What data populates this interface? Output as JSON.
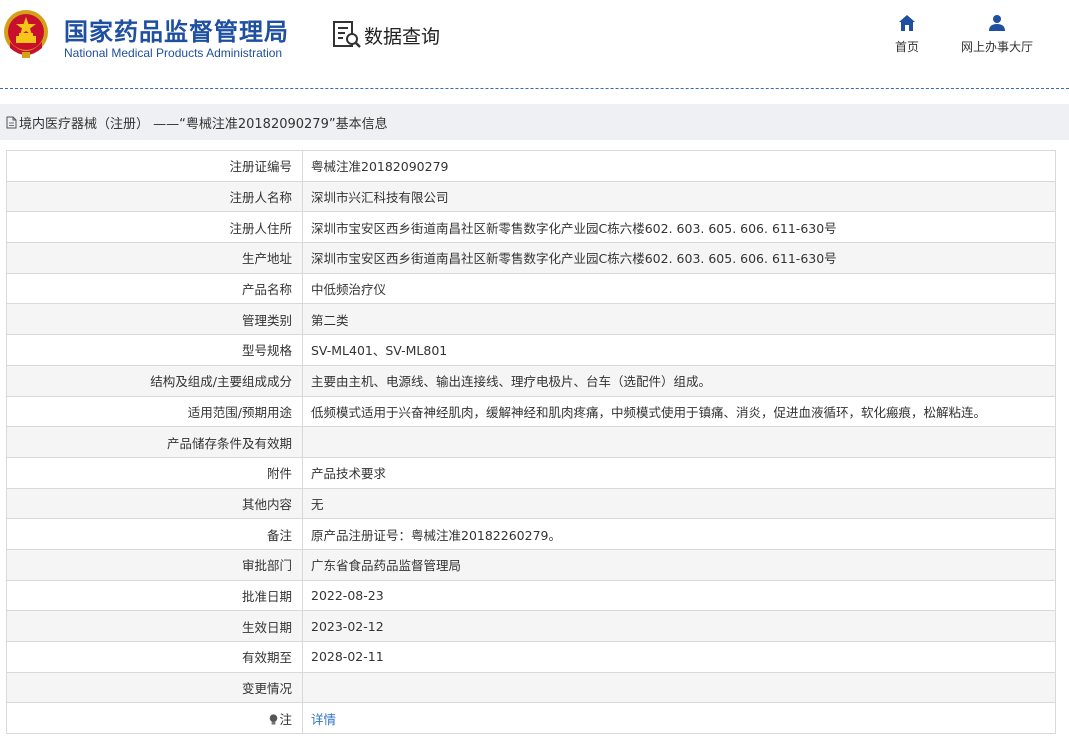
{
  "header": {
    "agency_cn": "国家药品监督管理局",
    "agency_en": "National Medical Products Administration",
    "query_label": "数据查询",
    "nav": [
      {
        "label": "首页",
        "icon": "home-icon"
      },
      {
        "label": "网上办事大厅",
        "icon": "user-icon"
      }
    ]
  },
  "breadcrumb": "境内医疗器械（注册） ——“粤械注准20182090279”基本信息",
  "rows": [
    {
      "label": "注册证编号",
      "value": "粤械注准20182090279"
    },
    {
      "label": "注册人名称",
      "value": "深圳市兴汇科技有限公司"
    },
    {
      "label": "注册人住所",
      "value": "深圳市宝安区西乡街道南昌社区新零售数字化产业园C栋六楼602. 603. 605. 606. 611-630号"
    },
    {
      "label": "生产地址",
      "value": "深圳市宝安区西乡街道南昌社区新零售数字化产业园C栋六楼602. 603. 605. 606. 611-630号"
    },
    {
      "label": "产品名称",
      "value": "中低频治疗仪"
    },
    {
      "label": "管理类别",
      "value": "第二类"
    },
    {
      "label": "型号规格",
      "value": "SV-ML401、SV-ML801"
    },
    {
      "label": "结构及组成/主要组成成分",
      "value": "主要由主机、电源线、输出连接线、理疗电极片、台车（选配件）组成。"
    },
    {
      "label": "适用范围/预期用途",
      "value": "低频模式适用于兴奋神经肌肉，缓解神经和肌肉疼痛，中频模式使用于镇痛、消炎，促进血液循环，软化瘢痕，松解粘连。"
    },
    {
      "label": "产品储存条件及有效期",
      "value": ""
    },
    {
      "label": "附件",
      "value": "产品技术要求"
    },
    {
      "label": "其他内容",
      "value": "无"
    },
    {
      "label": "备注",
      "value": "原产品注册证号：粤械注准20182260279。"
    },
    {
      "label": "审批部门",
      "value": "广东省食品药品监督管理局"
    },
    {
      "label": "批准日期",
      "value": "2022-08-23"
    },
    {
      "label": "生效日期",
      "value": "2023-02-12"
    },
    {
      "label": "有效期至",
      "value": "2028-02-11"
    },
    {
      "label": "变更情况",
      "value": ""
    }
  ],
  "note_row": {
    "label": "注",
    "link": "详情",
    "icon": "lightbulb-icon"
  },
  "colors": {
    "brand_blue": "#1e4fa0",
    "link_blue": "#2f74c0",
    "row_alt": "#f5f5f5"
  }
}
